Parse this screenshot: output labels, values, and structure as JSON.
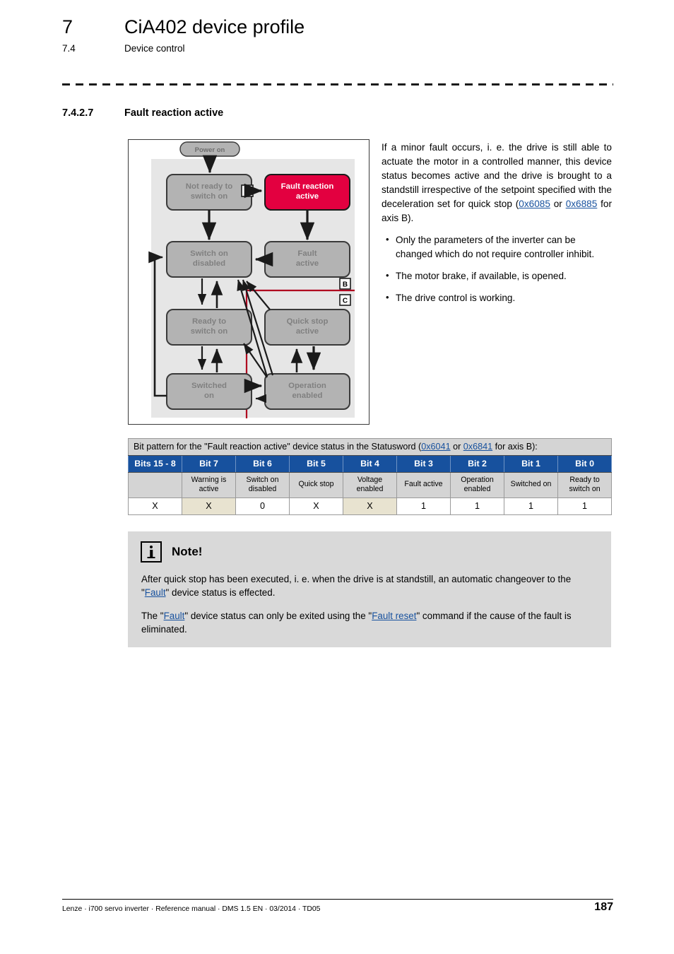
{
  "header": {
    "chapter_number": "7",
    "chapter_title": "CiA402 device profile",
    "section_number": "7.4",
    "section_title": "Device control"
  },
  "section": {
    "number": "7.4.2.7",
    "title": "Fault reaction active"
  },
  "diagram": {
    "entry_label": "Power on",
    "states": [
      {
        "id": "not-ready",
        "label_line1": "Not ready to",
        "label_line2": "switch on",
        "highlighted": false
      },
      {
        "id": "fault-reaction-active",
        "label_line1": "Fault reaction",
        "label_line2": "active",
        "highlighted": true
      },
      {
        "id": "switch-on-disabled",
        "label_line1": "Switch on",
        "label_line2": "disabled",
        "highlighted": false
      },
      {
        "id": "fault-active",
        "label_line1": "Fault",
        "label_line2": "active",
        "highlighted": false
      },
      {
        "id": "ready-to-switch-on",
        "label_line1": "Ready to",
        "label_line2": "switch on",
        "highlighted": false
      },
      {
        "id": "quick-stop-active",
        "label_line1": "Quick stop",
        "label_line2": "active",
        "highlighted": false
      },
      {
        "id": "switched-on",
        "label_line1": "Switched",
        "label_line2": "on",
        "highlighted": false
      },
      {
        "id": "operation-enabled",
        "label_line1": "Operation",
        "label_line2": "enabled",
        "highlighted": false
      }
    ],
    "markers": [
      {
        "id": "marker-a",
        "label": "A"
      },
      {
        "id": "marker-b",
        "label": "B"
      },
      {
        "id": "marker-c",
        "label": "C"
      }
    ],
    "colors": {
      "highlight": "#e30040",
      "state_fill": "#b3b3b3",
      "state_text": "#808080",
      "panel_bg": "#e6e6e6",
      "boundary_line": "#b00020"
    }
  },
  "description": {
    "paragraph_part1": "If a minor fault occurs, i. e. the drive is still able to actuate the motor in a controlled manner, this device status becomes active and the drive is brought to a standstill irrespective of the setpoint specified with the deceleration set for quick stop (",
    "link1": "0x6085",
    "paragraph_mid": " or ",
    "link2": "0x6885",
    "paragraph_end": " for axis B).",
    "bullets": [
      "Only the parameters of the inverter can be changed which do not require controller inhibit.",
      "The motor brake, if available, is opened.",
      "The drive control is working."
    ]
  },
  "bit_table": {
    "caption_part1": "Bit pattern for the \"Fault reaction active\" device status in the Statusword (",
    "caption_link1": "0x6041",
    "caption_mid": " or ",
    "caption_link2": "0x6841",
    "caption_end": " for axis B):",
    "headers": [
      "Bits 15 - 8",
      "Bit 7",
      "Bit 6",
      "Bit 5",
      "Bit 4",
      "Bit 3",
      "Bit 2",
      "Bit 1",
      "Bit 0"
    ],
    "descriptions": [
      "",
      "Warning is active",
      "Switch on disabled",
      "Quick stop",
      "Voltage enabled",
      "Fault active",
      "Operation enabled",
      "Switched on",
      "Ready to switch on"
    ],
    "values": [
      "X",
      "X",
      "0",
      "X",
      "X",
      "1",
      "1",
      "1",
      "1"
    ],
    "highlighted_columns": [
      1,
      4
    ],
    "header_color": "#17519e",
    "highlight_color": "#e8e3d0"
  },
  "note": {
    "title": "Note!",
    "paragraph1_part1": "After quick stop has been executed, i. e. when the drive is at standstill, an automatic changeover to the \"",
    "paragraph1_link": "Fault",
    "paragraph1_end": "\" device status is effected.",
    "paragraph2_part1": "The \"",
    "paragraph2_link1": "Fault",
    "paragraph2_mid": "\" device status can only be exited using the \"",
    "paragraph2_link2": "Fault reset",
    "paragraph2_end": "\" command if the cause of the fault is eliminated."
  },
  "footer": {
    "text": "Lenze · i700 servo inverter · Reference manual · DMS 1.5 EN · 03/2014 · TD05",
    "page_number": "187"
  }
}
